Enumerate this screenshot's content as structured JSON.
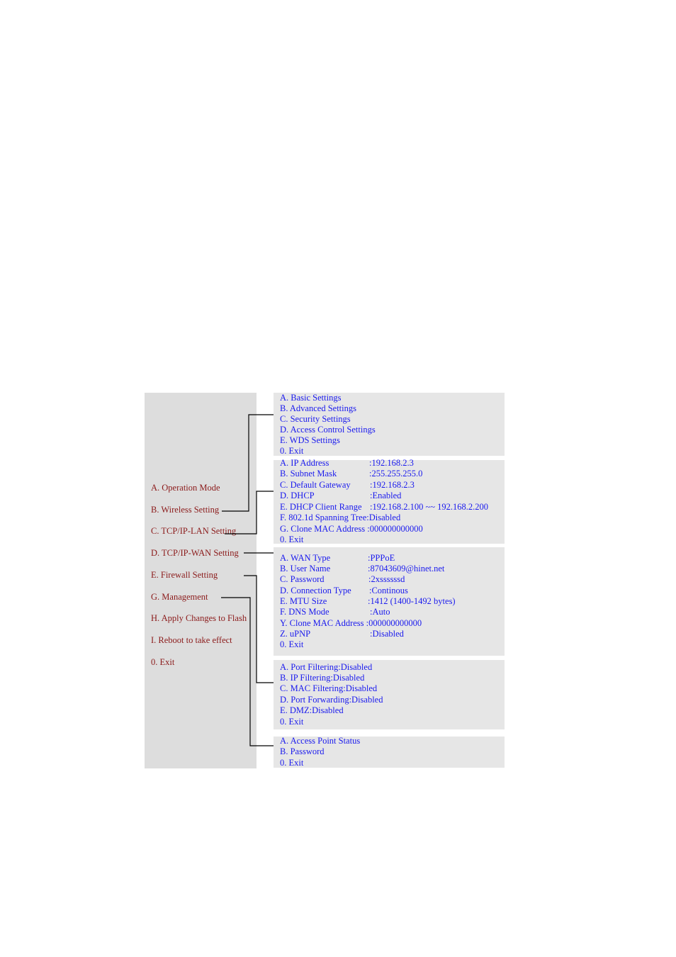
{
  "colors": {
    "main_menu_text": "#8b1a1a",
    "submenu_text": "#1a1aee",
    "panel_bg": "#dddddd",
    "submenu_bg": "#e6e6e6",
    "connector": "#000000"
  },
  "main_menu": {
    "items": [
      {
        "label": "A. Operation Mode"
      },
      {
        "label": "B. Wireless Setting"
      },
      {
        "label": "C. TCP/IP-LAN Setting"
      },
      {
        "label": "D. TCP/IP-WAN Setting"
      },
      {
        "label": "E. Firewall Setting"
      },
      {
        "label": "G. Management"
      },
      {
        "label": "H. Apply Changes to Flash"
      },
      {
        "label": "I. Reboot to take effect"
      },
      {
        "label": "0. Exit"
      }
    ]
  },
  "submenus": {
    "wireless": {
      "items": [
        {
          "label": "A. Basic Settings"
        },
        {
          "label": "B. Advanced Settings"
        },
        {
          "label": "C. Security Settings"
        },
        {
          "label": "D. Access Control Settings"
        },
        {
          "label": "E. WDS Settings"
        },
        {
          "label": "0. Exit"
        }
      ]
    },
    "lan": {
      "items": [
        {
          "label": "A. IP Address",
          "value": ":192.168.2.3"
        },
        {
          "label": "B. Subnet Mask",
          "value": ":255.255.255.0"
        },
        {
          "label": "C. Default Gateway",
          "value": ":192.168.2.3"
        },
        {
          "label": "D. DHCP",
          "value": ":Enabled"
        },
        {
          "label": "E. DHCP Client Range",
          "value": ":192.168.2.100  ~~ 192.168.2.200"
        },
        {
          "label": "F. 802.1d Spanning Tree",
          "value": ":Disabled"
        },
        {
          "label": "G. Clone MAC Address",
          "value": ":000000000000"
        },
        {
          "label": "0. Exit",
          "value": ""
        }
      ]
    },
    "wan": {
      "items": [
        {
          "label": "A. WAN Type",
          "value": ":PPPoE"
        },
        {
          "label": "B. User Name",
          "value": ":87043609@hinet.net"
        },
        {
          "label": "C. Password",
          "value": ":2xssssssd"
        },
        {
          "label": "D. Connection Type",
          "value": ":Continous"
        },
        {
          "label": "E. MTU Size",
          "value": ":1412 (1400-1492 bytes)"
        },
        {
          "label": "F. DNS Mode",
          "value": ":Auto"
        },
        {
          "label": "Y. Clone MAC Address",
          "value": ":000000000000"
        },
        {
          "label": "Z. uPNP",
          "value": ":Disabled"
        },
        {
          "label": "0. Exit",
          "value": ""
        }
      ]
    },
    "firewall": {
      "items": [
        {
          "label": "A. Port Filtering:Disabled"
        },
        {
          "label": "B. IP Filtering:Disabled"
        },
        {
          "label": "C. MAC Filtering:Disabled"
        },
        {
          "label": "D. Port Forwarding:Disabled"
        },
        {
          "label": "E. DMZ:Disabled"
        },
        {
          "label": "0. Exit"
        }
      ]
    },
    "management": {
      "items": [
        {
          "label": "A. Access Point Status"
        },
        {
          "label": "B. Password"
        },
        {
          "label": "0. Exit"
        }
      ]
    }
  }
}
